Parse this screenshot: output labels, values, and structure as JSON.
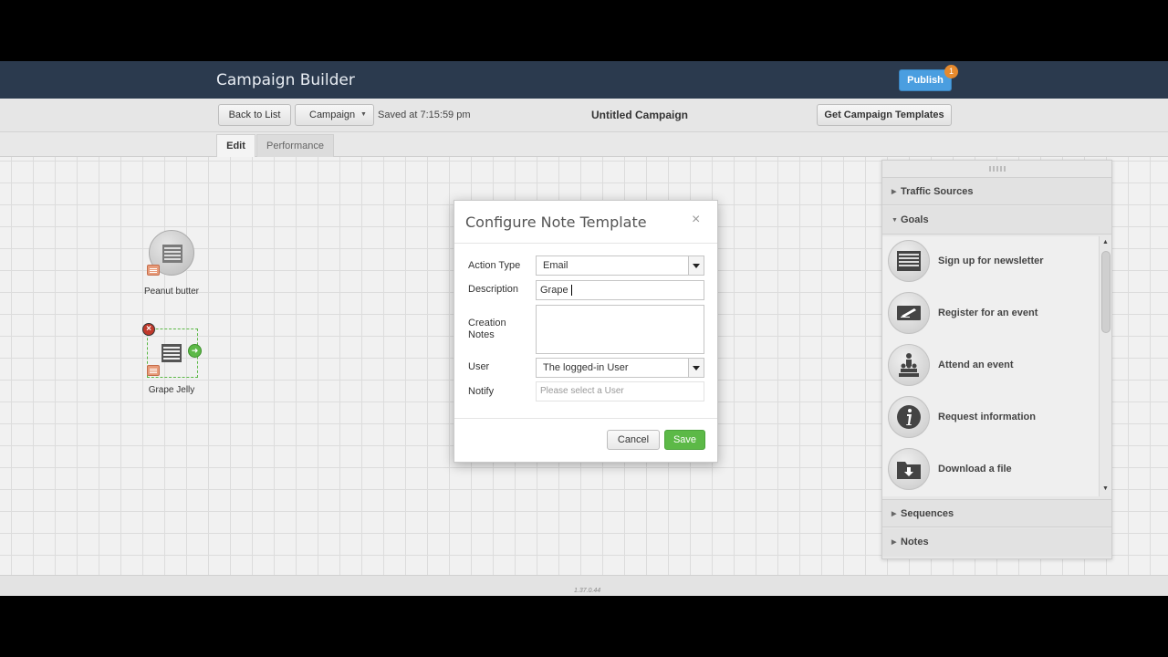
{
  "header": {
    "title": "Campaign Builder",
    "publish_label": "Publish",
    "publish_badge": "1"
  },
  "toolbar": {
    "back_label": "Back to List",
    "campaign_menu_label": "Campaign",
    "saved_text": "Saved at 7:15:59 pm",
    "campaign_name": "Untitled Campaign",
    "templates_label": "Get Campaign Templates"
  },
  "tabs": [
    {
      "label": "Edit",
      "active": true
    },
    {
      "label": "Performance",
      "active": false
    }
  ],
  "canvas": {
    "nodes": [
      {
        "label": "Peanut butter",
        "icon": "list-icon"
      },
      {
        "label": "Grape Jelly",
        "icon": "list-icon",
        "selected": true
      }
    ]
  },
  "panel": {
    "sections": [
      {
        "label": "Traffic Sources",
        "expanded": false
      },
      {
        "label": "Goals",
        "expanded": true
      },
      {
        "label": "Sequences",
        "expanded": false
      },
      {
        "label": "Notes",
        "expanded": false
      }
    ],
    "goals": [
      {
        "label": "Sign up for newsletter",
        "icon": "newsletter-icon"
      },
      {
        "label": "Register for an event",
        "icon": "register-icon"
      },
      {
        "label": "Attend an event",
        "icon": "audience-icon"
      },
      {
        "label": "Request information",
        "icon": "info-icon"
      },
      {
        "label": "Download a file",
        "icon": "download-icon"
      }
    ]
  },
  "dialog": {
    "title": "Configure Note Template",
    "close_glyph": "×",
    "action_type_label": "Action Type",
    "action_type_value": "Email",
    "description_label": "Description",
    "description_value": "Grape",
    "creation_notes_label_1": "Creation",
    "creation_notes_label_2": "Notes",
    "creation_notes_value": "",
    "user_label": "User",
    "user_value": "The logged-in User",
    "notify_label": "Notify",
    "notify_placeholder": "Please select a User",
    "cancel_label": "Cancel",
    "save_label": "Save"
  },
  "footer": {
    "version": "1.37.0.44"
  },
  "colors": {
    "titlebar": "#2b3a4e",
    "publish": "#4a9ee0",
    "badge": "#e68a2e",
    "save": "#5cb947"
  }
}
